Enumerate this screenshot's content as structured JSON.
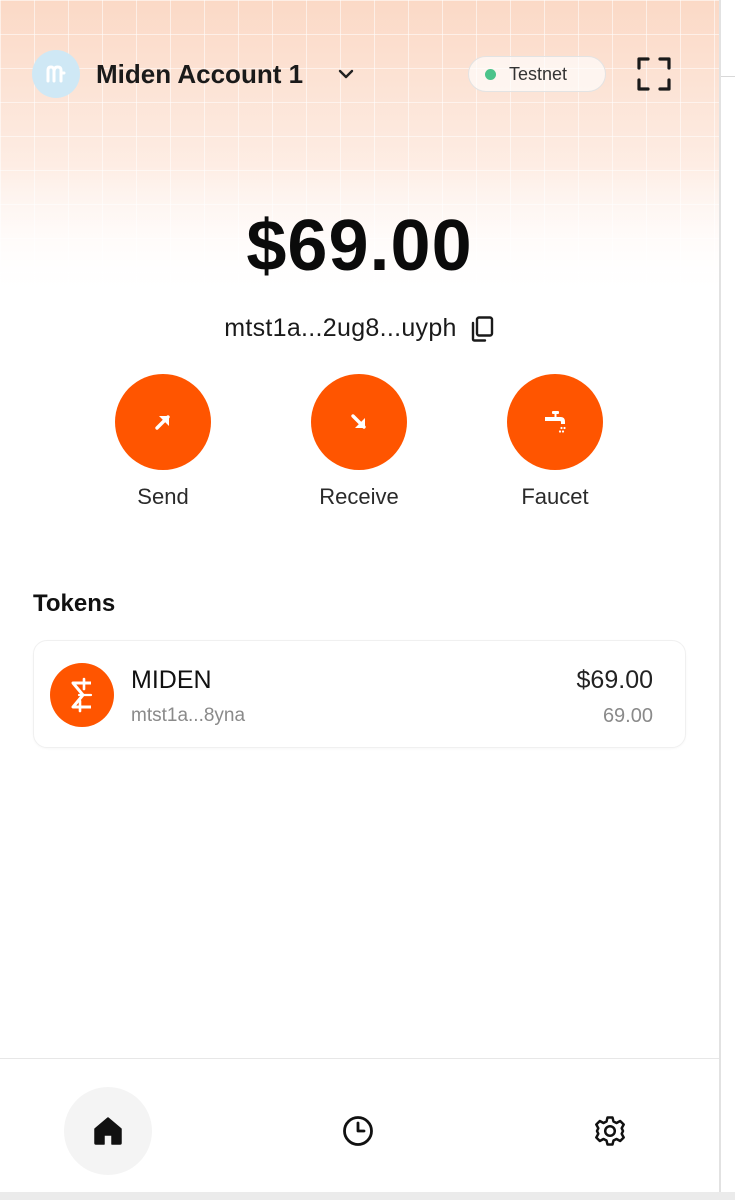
{
  "header": {
    "account_name": "Miden Account 1",
    "network_label": "Testnet",
    "avatar_icon": "miden-logo-icon",
    "dropdown_icon": "chevron-down-icon",
    "expand_icon": "fullscreen-icon"
  },
  "wallet": {
    "balance": "$69.00",
    "address": "mtst1a...2ug8...uyph",
    "copy_icon": "copy-icon"
  },
  "actions": [
    {
      "label": "Send",
      "icon": "arrow-up-right-icon"
    },
    {
      "label": "Receive",
      "icon": "arrow-down-right-icon"
    },
    {
      "label": "Faucet",
      "icon": "faucet-icon"
    }
  ],
  "tokens": {
    "heading": "Tokens",
    "items": [
      {
        "name": "MIDEN",
        "address": "mtst1a...8yna",
        "value": "$69.00",
        "amount": "69.00",
        "icon": "miden-token-icon"
      }
    ]
  },
  "nav": [
    {
      "label": "home",
      "icon": "home-icon",
      "active": true
    },
    {
      "label": "history",
      "icon": "clock-icon",
      "active": false
    },
    {
      "label": "settings",
      "icon": "gear-icon",
      "active": false
    }
  ],
  "colors": {
    "accent": "#ff5500",
    "status_online": "#4cc38a",
    "avatar_bg": "#cfe8f5"
  }
}
